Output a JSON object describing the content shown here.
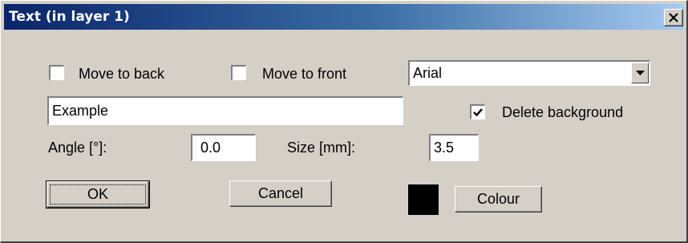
{
  "window": {
    "title": "Text (in layer 1)"
  },
  "options": {
    "move_to_back_label": "Move to back",
    "move_to_back_checked": false,
    "move_to_front_label": "Move to front",
    "move_to_front_checked": false,
    "delete_background_label": "Delete background",
    "delete_background_checked": true
  },
  "font": {
    "selected": "Arial"
  },
  "text": {
    "value": "Example"
  },
  "angle": {
    "label": "Angle [°]:",
    "value": "0.0"
  },
  "size": {
    "label": "Size [mm]:",
    "value": "3.5"
  },
  "buttons": {
    "ok": "OK",
    "cancel": "Cancel",
    "colour": "Colour"
  },
  "colour": {
    "current": "#000000"
  },
  "icons": {
    "close": "close-icon",
    "dropdown": "chevron-down-icon",
    "check": "checkmark-icon"
  }
}
